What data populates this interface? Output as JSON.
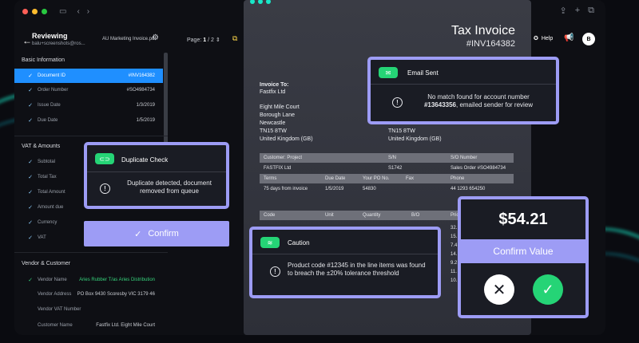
{
  "app": {
    "title": "Reviewing",
    "user": "balu+screenshots@ros...",
    "filename": "AU Marketing Invoice.pdf",
    "page_label": "Page:",
    "page_current": "1",
    "page_sep": "/",
    "page_total": "2",
    "help_label": "Help",
    "avatar_letter": "B"
  },
  "sidebar": {
    "basic_title": "Basic Information",
    "basic_items": [
      {
        "label": "Document ID",
        "value": "#INV164382"
      },
      {
        "label": "Order Number",
        "value": "#SO4984734"
      },
      {
        "label": "Issue Date",
        "value": "1/3/2019"
      },
      {
        "label": "Due Date",
        "value": "1/5/2019"
      }
    ],
    "vat_title": "VAT & Amounts",
    "vat_items": [
      {
        "label": "Subtotal"
      },
      {
        "label": "Total Tax"
      },
      {
        "label": "Total Amount"
      },
      {
        "label": "Amount due"
      },
      {
        "label": "Currency"
      },
      {
        "label": "VAT"
      }
    ],
    "vendor_title": "Vendor & Customer",
    "vendor_items": [
      {
        "label": "Vendor Name",
        "value": "Aries Rubber T/as Aries Distribution"
      },
      {
        "label": "Vendor Address",
        "value": "PO Box 9430 Scoresby VIC 3179 46"
      },
      {
        "label": "Vendor VAT Number",
        "value": ""
      },
      {
        "label": "Customer Name",
        "value": "Fastfix Ltd. Eight Mile Court"
      }
    ]
  },
  "invoice": {
    "title": "Tax Invoice",
    "number": "#INV164382",
    "to_label": "Invoice To:",
    "to_company": "Fastfix Ltd",
    "address": [
      "Eight Mile Court",
      "Borough Lane",
      "Newcastle",
      "TN15 8TW",
      "United Kingdom (GB)"
    ],
    "address_right": [
      "TN15 8TW",
      "United Kingdom (GB)"
    ],
    "t1_headers": [
      "Customer: Project",
      "S/N",
      "S/O Number"
    ],
    "t1_row": [
      "FASTFIX Ltd",
      "S1742",
      "Sales Order #SO4984734"
    ],
    "t2_headers": [
      "Terms",
      "Due Date",
      "Your PO No.",
      "Fax",
      "Phone"
    ],
    "t2_row": [
      "75 days from invoice",
      "1/5/2019",
      "54830",
      "",
      "44 1293 654250"
    ],
    "t3_headers": [
      "Code",
      "Unit",
      "Quantity",
      "B/O",
      "Pric"
    ],
    "price_fragments": [
      "32.",
      "15.",
      "7.4",
      "14.",
      "9.2",
      "11.",
      "10."
    ]
  },
  "email_card": {
    "title": "Email Sent",
    "body_pre": "No match found for account number",
    "body_bold": "#13643356",
    "body_post": ", emailed sender for review"
  },
  "dup_card": {
    "title": "Duplicate Check",
    "body": "Duplicate detected, document removed from queue"
  },
  "confirm_button": {
    "label": "Confirm"
  },
  "caution_card": {
    "title": "Caution",
    "body": "Product code #12345 in the line items was found to breach the ±20% tolerance threshold"
  },
  "confirm_value": {
    "amount": "$54.21",
    "label": "Confirm Value"
  },
  "colors": {
    "accent": "#9d9cf5",
    "green": "#25d476",
    "active": "#1f8fff"
  }
}
